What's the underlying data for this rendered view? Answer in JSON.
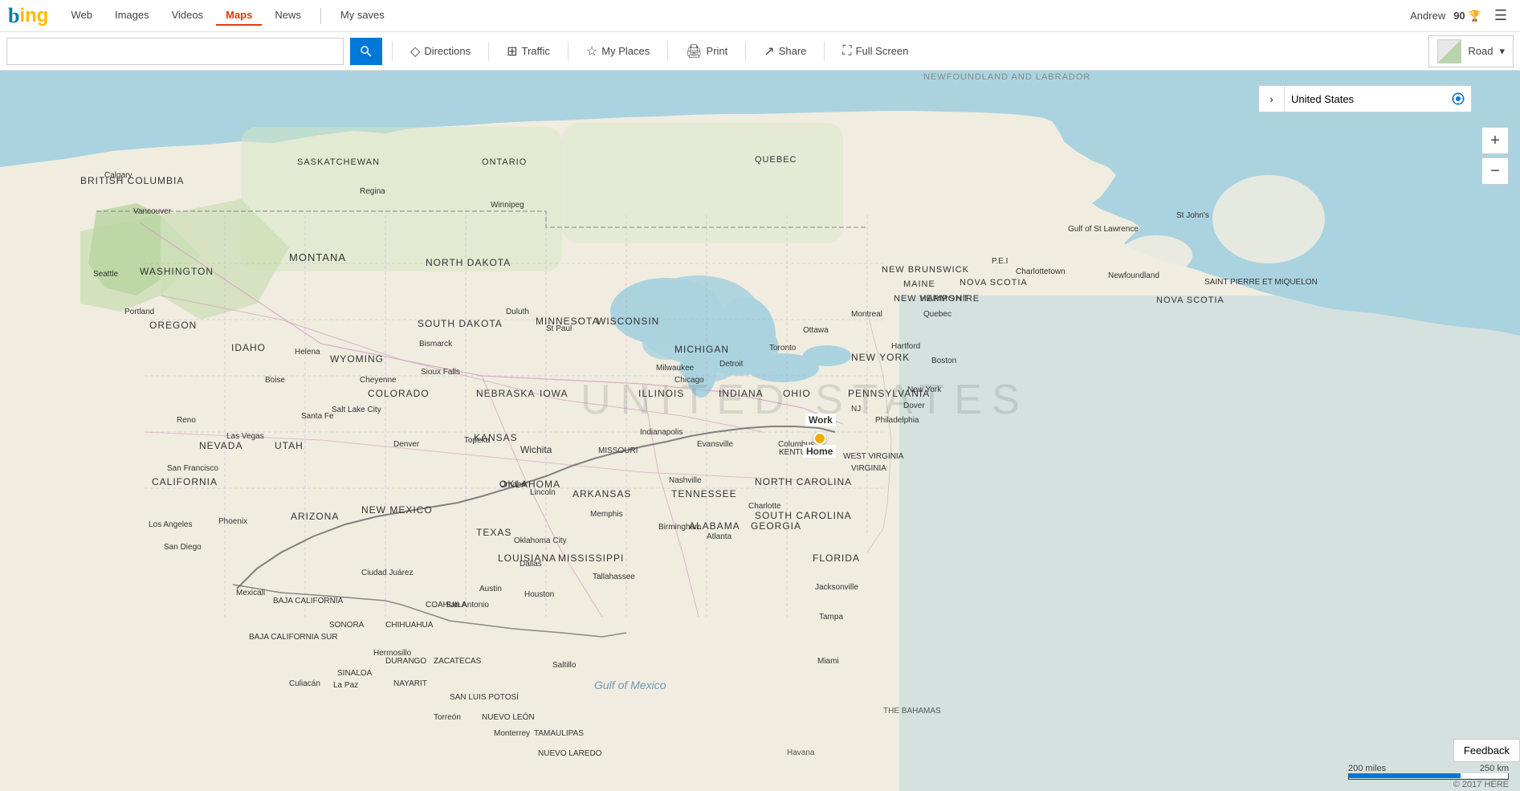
{
  "app": {
    "title": "Bing Maps",
    "logo": "b",
    "logo_color_b": "#00809d",
    "logo_color_ing": "#ffb900"
  },
  "nav": {
    "items": [
      {
        "label": "Web",
        "active": false
      },
      {
        "label": "Images",
        "active": false
      },
      {
        "label": "Videos",
        "active": false
      },
      {
        "label": "Maps",
        "active": true
      },
      {
        "label": "News",
        "active": false
      },
      {
        "label": "My saves",
        "active": false
      }
    ]
  },
  "user": {
    "name": "Andrew",
    "reward_count": "90",
    "reward_icon": "🏆"
  },
  "search": {
    "placeholder": "",
    "value": ""
  },
  "toolbar": {
    "directions_label": "Directions",
    "traffic_label": "Traffic",
    "my_places_label": "My Places",
    "print_label": "Print",
    "share_label": "Share",
    "full_screen_label": "Full Screen"
  },
  "map": {
    "view_type": "Road",
    "location_value": "United States",
    "watermark": "UNITED STATES",
    "newfoundland_label": "NEWFOUNDLAND AND LABRADOR",
    "markers": {
      "home_label": "Home",
      "work_label": "Work"
    }
  },
  "scale": {
    "miles_label": "200 miles",
    "km_label": "250 km"
  },
  "copyright": "© 2017 HERE",
  "feedback": {
    "label": "Feedback"
  }
}
